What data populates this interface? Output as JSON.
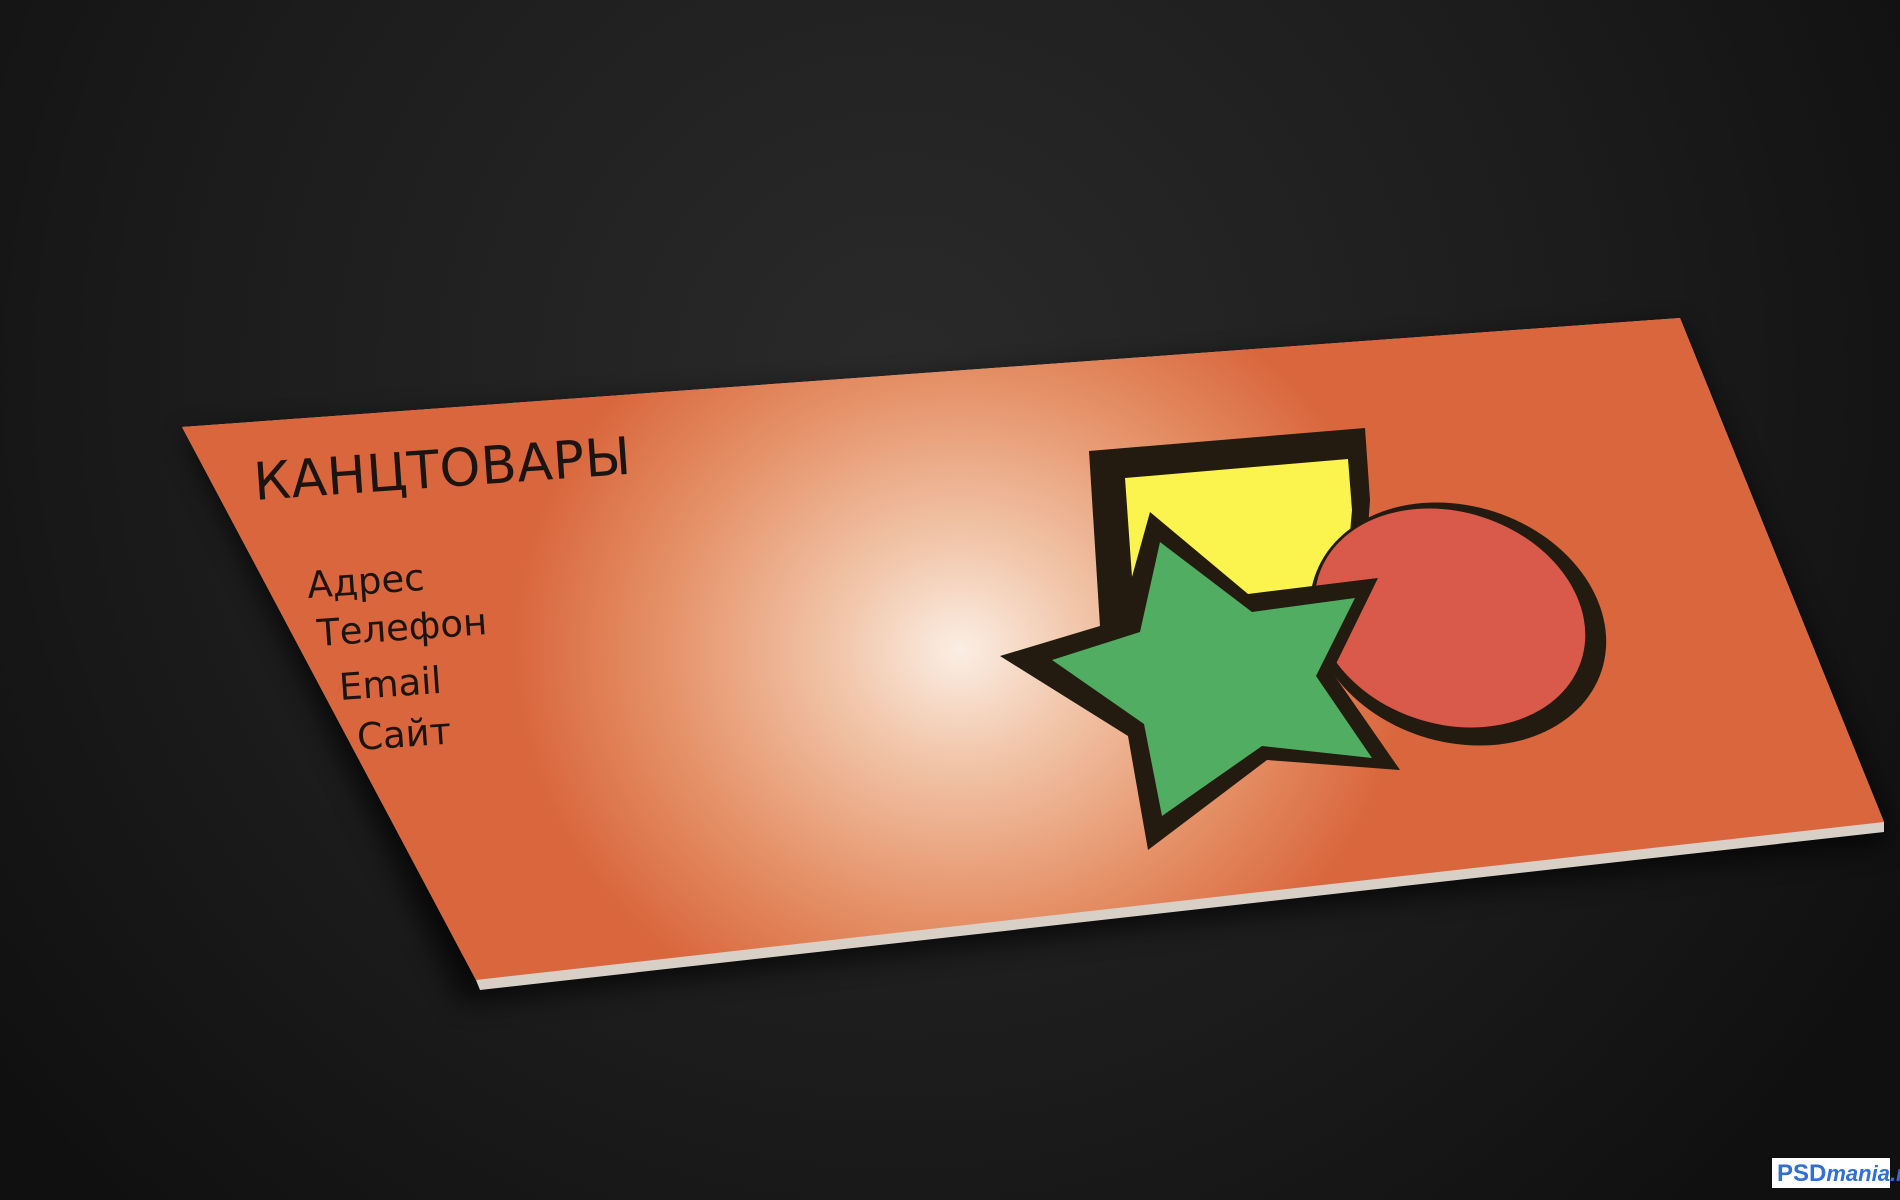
{
  "card": {
    "title": "КАНЦТОВАРЫ",
    "lines": [
      "Адрес",
      "Телефон",
      "Email",
      "Сайт"
    ]
  },
  "watermark": {
    "brand": "PSD",
    "rest": "mania.ru"
  },
  "colors": {
    "background": "#1a1a1a",
    "card_orange": "#d9663c",
    "card_highlight": "#fbeee4",
    "star_green": "#50ad62",
    "circle_red": "#d9594a",
    "square_yellow": "#fbf34e",
    "outline": "#231a10",
    "watermark_blue": "#2f6fd6"
  },
  "icons": [
    "square-shape-icon",
    "circle-shape-icon",
    "star-shape-icon"
  ]
}
